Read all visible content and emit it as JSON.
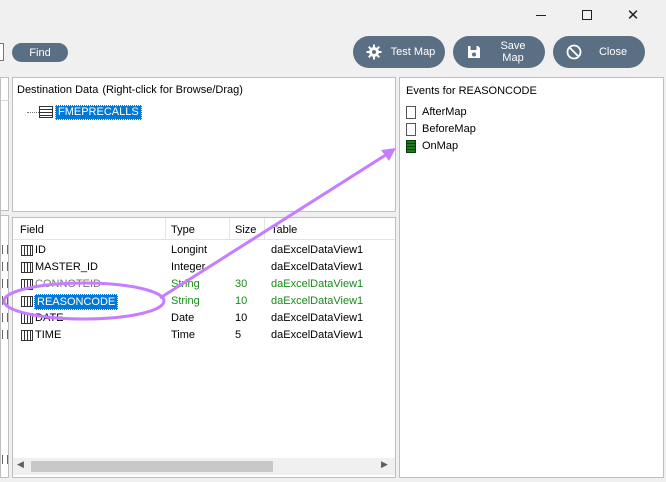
{
  "window": {
    "controls": [
      "minimize",
      "maximize",
      "close"
    ]
  },
  "toolbar": {
    "find_label": "Find",
    "test_map_label": "Test Map",
    "save_map_label": "Save Map",
    "close_label": "Close"
  },
  "destination": {
    "header": "Destination Data",
    "hint": "(Right-click for Browse/Drag)",
    "tree_root": "FMEPRECALLS"
  },
  "fields_grid": {
    "columns": [
      "Field",
      "Type",
      "Size",
      "Table"
    ],
    "rows": [
      {
        "field": "ID",
        "type": "Longint",
        "size": "",
        "table": "daExcelDataView1"
      },
      {
        "field": "MASTER_ID",
        "type": "Integer",
        "size": "",
        "table": "daExcelDataView1"
      },
      {
        "field": "CONNOTEID",
        "type": "String",
        "size": "30",
        "table": "daExcelDataView1"
      },
      {
        "field": "REASONCODE",
        "type": "String",
        "size": "10",
        "table": "daExcelDataView1"
      },
      {
        "field": "DATE",
        "type": "Date",
        "size": "10",
        "table": "daExcelDataView1"
      },
      {
        "field": "TIME",
        "type": "Time",
        "size": "5",
        "table": "daExcelDataView1"
      }
    ]
  },
  "events": {
    "header": "Events for REASONCODE",
    "items": [
      "AfterMap",
      "BeforeMap",
      "OnMap"
    ]
  },
  "colors": {
    "button_bg": "#5b6f84",
    "selection": "#0078d7",
    "mapped_text": "#1a8a1a",
    "annotation": "#c77dff"
  }
}
